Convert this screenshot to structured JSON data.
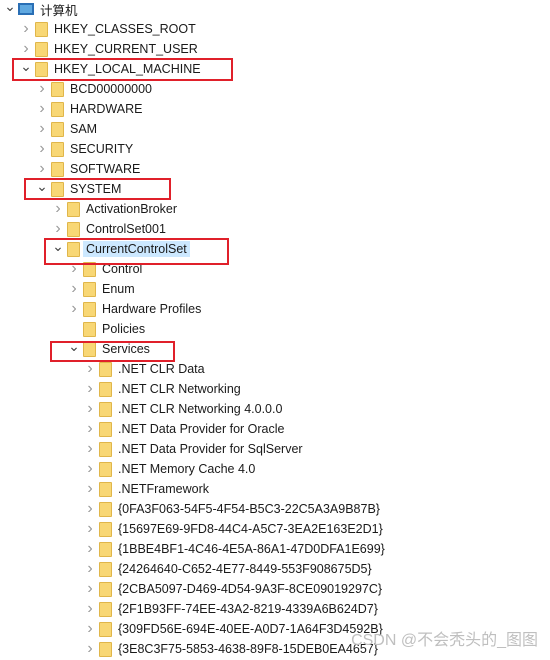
{
  "tree": [
    {
      "label": "计算机",
      "level": 0,
      "state": "expanded",
      "icon": "computer-icon"
    },
    {
      "label": "HKEY_CLASSES_ROOT",
      "level": 1,
      "state": "collapsed"
    },
    {
      "label": "HKEY_CURRENT_USER",
      "level": 1,
      "state": "collapsed"
    },
    {
      "label": "HKEY_LOCAL_MACHINE",
      "level": 1,
      "state": "expanded",
      "highlighted": true
    },
    {
      "label": "BCD00000000",
      "level": 2,
      "state": "collapsed"
    },
    {
      "label": "HARDWARE",
      "level": 2,
      "state": "collapsed"
    },
    {
      "label": "SAM",
      "level": 2,
      "state": "collapsed"
    },
    {
      "label": "SECURITY",
      "level": 2,
      "state": "collapsed"
    },
    {
      "label": "SOFTWARE",
      "level": 2,
      "state": "collapsed"
    },
    {
      "label": "SYSTEM",
      "level": 2,
      "state": "expanded",
      "highlighted": true
    },
    {
      "label": "ActivationBroker",
      "level": 3,
      "state": "collapsed"
    },
    {
      "label": "ControlSet001",
      "level": 3,
      "state": "collapsed"
    },
    {
      "label": "CurrentControlSet",
      "level": 3,
      "state": "expanded",
      "selected": true,
      "highlighted": true
    },
    {
      "label": "Control",
      "level": 4,
      "state": "collapsed"
    },
    {
      "label": "Enum",
      "level": 4,
      "state": "collapsed"
    },
    {
      "label": "Hardware Profiles",
      "level": 4,
      "state": "collapsed"
    },
    {
      "label": "Policies",
      "level": 4,
      "state": "leaf"
    },
    {
      "label": "Services",
      "level": 4,
      "state": "expanded",
      "highlighted": true
    },
    {
      "label": ".NET CLR Data",
      "level": 5,
      "state": "collapsed"
    },
    {
      "label": ".NET CLR Networking",
      "level": 5,
      "state": "collapsed"
    },
    {
      "label": ".NET CLR Networking 4.0.0.0",
      "level": 5,
      "state": "collapsed"
    },
    {
      "label": ".NET Data Provider for Oracle",
      "level": 5,
      "state": "collapsed"
    },
    {
      "label": ".NET Data Provider for SqlServer",
      "level": 5,
      "state": "collapsed"
    },
    {
      "label": ".NET Memory Cache 4.0",
      "level": 5,
      "state": "collapsed"
    },
    {
      "label": ".NETFramework",
      "level": 5,
      "state": "collapsed"
    },
    {
      "label": "{0FA3F063-54F5-4F54-B5C3-22C5A3A9B87B}",
      "level": 5,
      "state": "collapsed"
    },
    {
      "label": "{15697E69-9FD8-44C4-A5C7-3EA2E163E2D1}",
      "level": 5,
      "state": "collapsed"
    },
    {
      "label": "{1BBE4BF1-4C46-4E5A-86A1-47D0DFA1E699}",
      "level": 5,
      "state": "collapsed"
    },
    {
      "label": "{24264640-C652-4E77-8449-553F908675D5}",
      "level": 5,
      "state": "collapsed"
    },
    {
      "label": "{2CBA5097-D469-4D54-9A3F-8CE09019297C}",
      "level": 5,
      "state": "collapsed"
    },
    {
      "label": "{2F1B93FF-74EE-43A2-8219-4339A6B624D7}",
      "level": 5,
      "state": "collapsed"
    },
    {
      "label": "{309FD56E-694E-40EE-A0D7-1A64F3D4592B}",
      "level": 5,
      "state": "collapsed"
    },
    {
      "label": "{3E8C3F75-5853-4638-89F8-15DEB0EA4657}",
      "level": 5,
      "state": "collapsed"
    }
  ],
  "highlight_color": "#e0202a",
  "selection_color": "#cce8ff",
  "watermark": "CSDN @不会秃头的_图图"
}
